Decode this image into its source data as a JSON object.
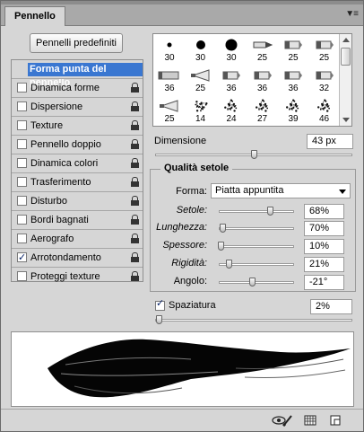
{
  "panel": {
    "title": "Pennello",
    "menu_icon": "panel-menu-icon"
  },
  "presets_button": "Pennelli predefiniti",
  "left_list": {
    "items": [
      {
        "label": "Forma punta del pennello",
        "selected": true,
        "checkbox": false,
        "checked": false,
        "locked": false
      },
      {
        "label": "Dinamica forme",
        "checkbox": true,
        "checked": false,
        "locked": true
      },
      {
        "label": "Dispersione",
        "checkbox": true,
        "checked": false,
        "locked": true
      },
      {
        "label": "Texture",
        "checkbox": true,
        "checked": false,
        "locked": true
      },
      {
        "label": "Pennello doppio",
        "checkbox": true,
        "checked": false,
        "locked": true
      },
      {
        "label": "Dinamica colori",
        "checkbox": true,
        "checked": false,
        "locked": true
      },
      {
        "label": "Trasferimento",
        "checkbox": true,
        "checked": false,
        "locked": true
      },
      {
        "label": "Disturbo",
        "checkbox": true,
        "checked": false,
        "locked": true
      },
      {
        "label": "Bordi bagnati",
        "checkbox": true,
        "checked": false,
        "locked": true
      },
      {
        "label": "Aerografo",
        "checkbox": true,
        "checked": false,
        "locked": true
      },
      {
        "label": "Arrotondamento",
        "checkbox": true,
        "checked": true,
        "locked": true
      },
      {
        "label": "Proteggi texture",
        "checkbox": true,
        "checked": false,
        "locked": true
      }
    ]
  },
  "brush_grid": {
    "rows": [
      [
        {
          "n": "30",
          "k": "dot-s"
        },
        {
          "n": "30",
          "k": "dot-m"
        },
        {
          "n": "30",
          "k": "dot-l"
        },
        {
          "n": "25",
          "k": "pen"
        },
        {
          "n": "25",
          "k": "flat"
        },
        {
          "n": "25",
          "k": "flat2"
        }
      ],
      [
        {
          "n": "36",
          "k": "wide"
        },
        {
          "n": "25",
          "k": "fan"
        },
        {
          "n": "36",
          "k": "flat3"
        },
        {
          "n": "36",
          "k": "flat4"
        },
        {
          "n": "36",
          "k": "flat5"
        },
        {
          "n": "32",
          "k": "flat6"
        }
      ],
      [
        {
          "n": "25",
          "k": "fan2"
        },
        {
          "n": "14",
          "k": "spray"
        },
        {
          "n": "24",
          "k": "spray2"
        },
        {
          "n": "27",
          "k": "spray3"
        },
        {
          "n": "39",
          "k": "spray4"
        },
        {
          "n": "46",
          "k": "spray5"
        }
      ]
    ]
  },
  "dimensione": {
    "label": "Dimensione",
    "value": "43 px",
    "level": 0.5
  },
  "qualita": {
    "title": "Qualità setole",
    "forma_label": "Forma:",
    "forma_value": "Piatta appuntita",
    "rows": [
      {
        "label": "Setole:",
        "value": "68%",
        "level": 0.68,
        "italic": true
      },
      {
        "label": "Lunghezza:",
        "value": "70%",
        "level": 0.05,
        "italic": true
      },
      {
        "label": "Spessore:",
        "value": "10%",
        "level": 0.02,
        "italic": true
      },
      {
        "label": "Rigidità:",
        "value": "21%",
        "level": 0.13,
        "italic": true
      },
      {
        "label": "Angolo:",
        "value": "-21°",
        "level": 0.44,
        "italic": false
      }
    ]
  },
  "spaziatura": {
    "label": "Spaziatura",
    "checked": true,
    "value": "2%",
    "level": 0.02
  },
  "bottom_icons": [
    "toggle-preview-icon",
    "grid-icon",
    "new-preset-icon"
  ]
}
